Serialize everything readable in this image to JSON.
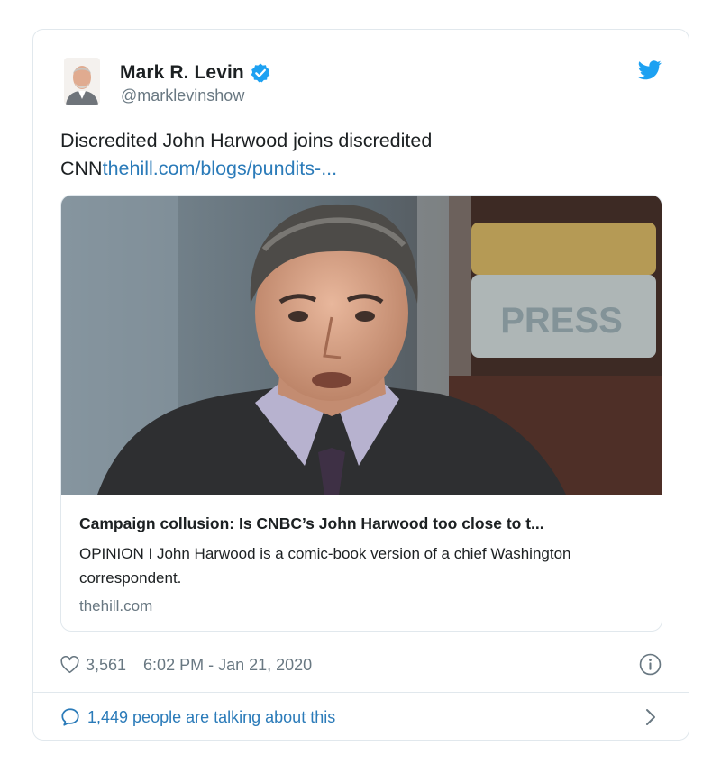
{
  "author": {
    "display_name": "Mark R. Levin",
    "handle": "@marklevinshow",
    "verified": true
  },
  "tweet": {
    "text": "Discredited John Harwood joins discredited CNN",
    "link_text": "thehill.com/blogs/pundits-..."
  },
  "link_card": {
    "image_text": "PRESS",
    "title": "Campaign collusion: Is CNBC’s John Harwood too close to t...",
    "description": "OPINION I John Harwood is a comic-book version of a chief Washington correspondent.",
    "domain": "thehill.com"
  },
  "meta": {
    "likes": "3,561",
    "timestamp": "6:02 PM - Jan 21, 2020"
  },
  "footer": {
    "talking": "1,449 people are talking about this"
  },
  "icons": {
    "platform": "twitter-bird-icon",
    "verified": "verified-badge-icon",
    "like": "heart-icon",
    "info": "info-icon",
    "reply": "speech-bubble-icon",
    "more": "chevron-right-icon"
  },
  "colors": {
    "brand_blue": "#1da1f2",
    "link_blue": "#2b7bb9",
    "secondary_text": "#697882",
    "border": "#e1e8ed"
  }
}
